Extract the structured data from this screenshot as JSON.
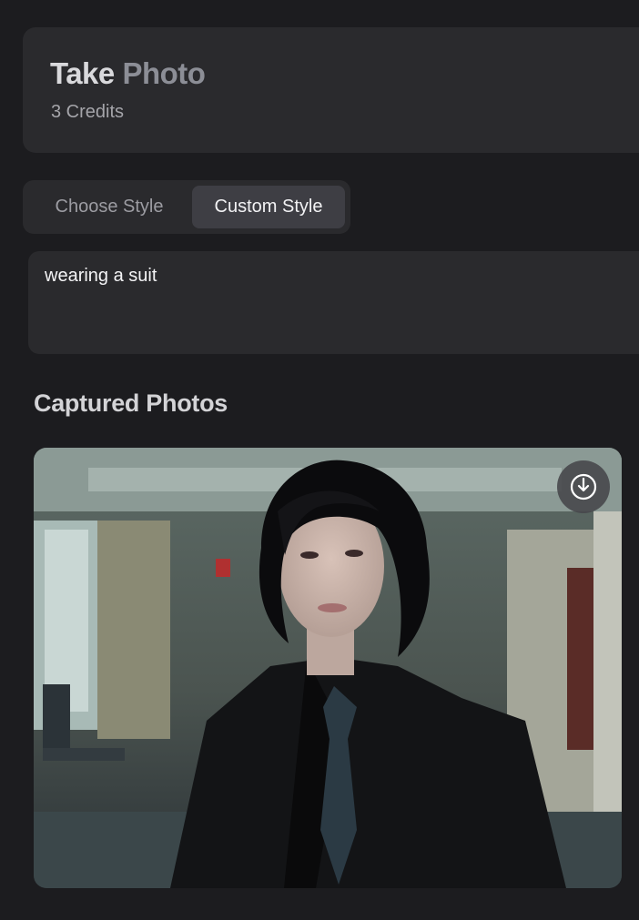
{
  "header": {
    "title_word1": "Take",
    "title_word2": "Photo",
    "credits": "3 Credits"
  },
  "tabs": [
    {
      "label": "Choose Style",
      "active": false
    },
    {
      "label": "Custom Style",
      "active": true
    }
  ],
  "prompt": {
    "value": "wearing a suit"
  },
  "captured": {
    "title": "Captured Photos",
    "photos": [
      {
        "download_icon": "download-icon"
      }
    ]
  },
  "colors": {
    "background": "#1c1c1f",
    "card": "#2a2a2d",
    "active_tab": "#3e3e44"
  }
}
